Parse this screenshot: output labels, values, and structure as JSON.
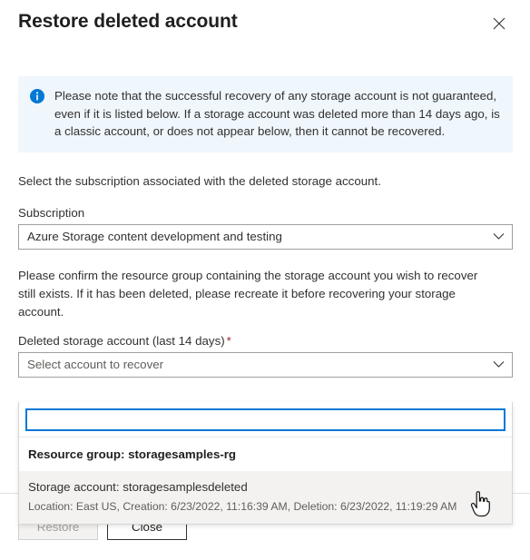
{
  "header": {
    "title": "Restore deleted account",
    "close_icon": "close-icon"
  },
  "info_banner": {
    "icon": "info-icon",
    "text": "Please note that the successful recovery of any storage account is not guaranteed, even if it is listed below. If a storage account was deleted more than 14 days ago, is a classic account, or does not appear below, then it cannot be recovered.",
    "background": "#eff6fc",
    "icon_color": "#0078d4"
  },
  "main": {
    "subscription_intro": "Select the subscription associated with the deleted storage account.",
    "subscription_label": "Subscription",
    "subscription_value": "Azure Storage content development and testing",
    "resource_group_note": "Please confirm the resource group containing the storage account you wish to recover still exists. If it has been deleted, please recreate it before recovering your storage account.",
    "account_label": "Deleted storage account (last 14 days)",
    "account_required_mark": "*",
    "account_placeholder": "Select account to recover",
    "chevron_icon": "chevron-down-icon"
  },
  "dropdown": {
    "search_value": "",
    "search_placeholder": "",
    "group_header": "Resource group: storagesamples-rg",
    "options": [
      {
        "title": "Storage account: storagesamplesdeleted",
        "details": "Location: East US, Creation: 6/23/2022, 11:16:39 AM, Deletion: 6/23/2022, 11:19:29 AM"
      }
    ],
    "focus_color": "#0078d4",
    "hover_background": "#f3f2f1"
  },
  "footer": {
    "restore_label": "Restore",
    "close_label": "Close"
  },
  "cursor": {
    "type": "hand-pointer-cursor"
  }
}
